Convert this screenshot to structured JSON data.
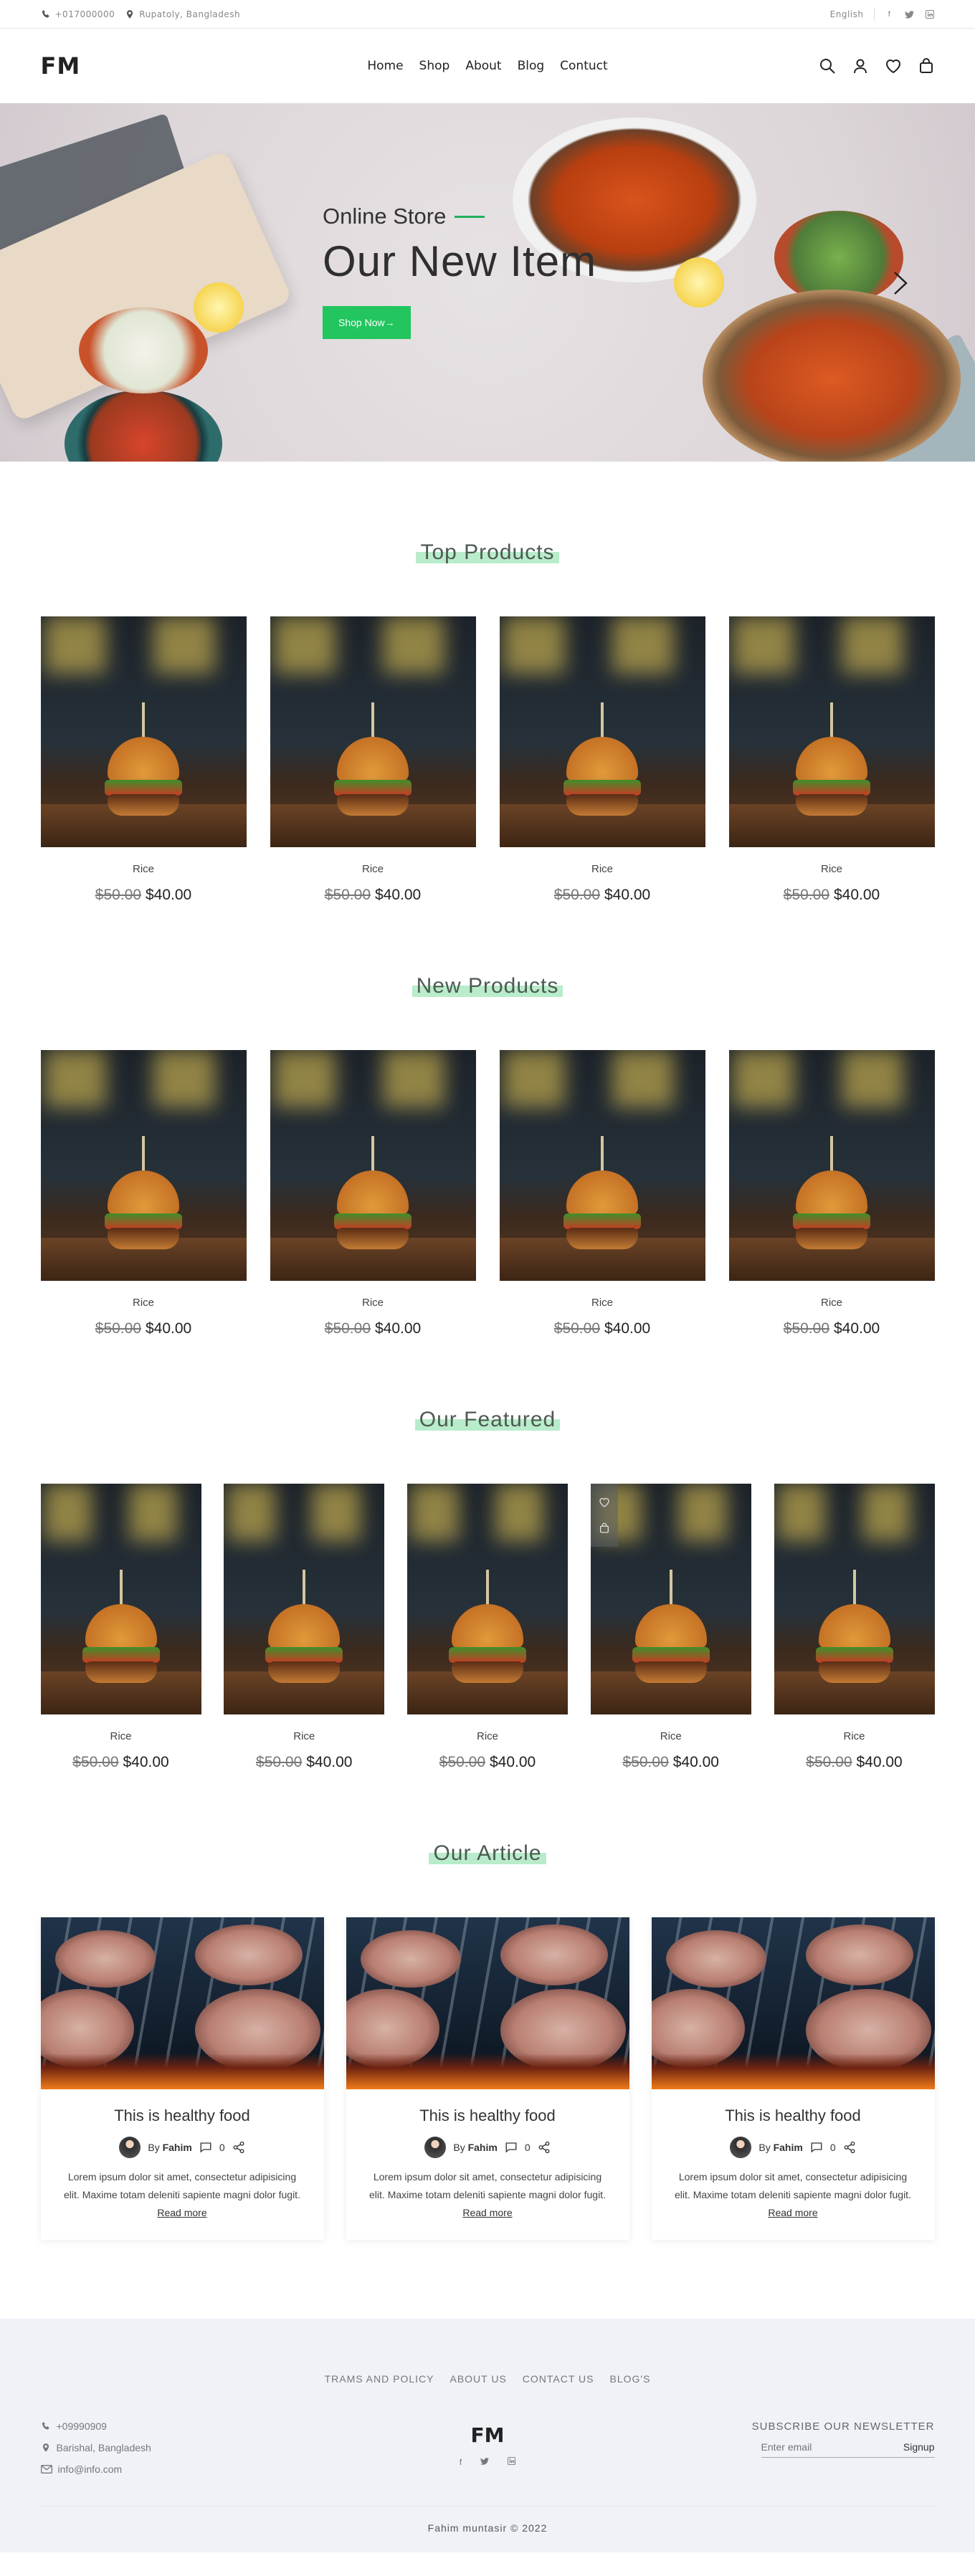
{
  "topbar": {
    "phone": "+017000000",
    "location": "Rupatoly, Bangladesh",
    "language": "English",
    "social": [
      "facebook-icon",
      "twitter-icon",
      "linkedin-icon"
    ]
  },
  "header": {
    "logo": "FM",
    "nav": [
      "Home",
      "Shop",
      "About",
      "Blog",
      "Contuct"
    ],
    "icons": [
      "search-icon",
      "user-icon",
      "heart-icon",
      "bag-icon"
    ]
  },
  "hero": {
    "subtitle": "Online Store",
    "title": "Our New Item",
    "button": "Shop Now→"
  },
  "top_products": {
    "title": "Top Products",
    "items": [
      {
        "name": "Rice",
        "old_price": "$50.00",
        "price": "$40.00"
      },
      {
        "name": "Rice",
        "old_price": "$50.00",
        "price": "$40.00"
      },
      {
        "name": "Rice",
        "old_price": "$50.00",
        "price": "$40.00"
      },
      {
        "name": "Rice",
        "old_price": "$50.00",
        "price": "$40.00"
      }
    ]
  },
  "new_products": {
    "title": "New Products",
    "items": [
      {
        "name": "Rice",
        "old_price": "$50.00",
        "price": "$40.00"
      },
      {
        "name": "Rice",
        "old_price": "$50.00",
        "price": "$40.00"
      },
      {
        "name": "Rice",
        "old_price": "$50.00",
        "price": "$40.00"
      },
      {
        "name": "Rice",
        "old_price": "$50.00",
        "price": "$40.00"
      }
    ]
  },
  "featured": {
    "title": "Our Featured",
    "items": [
      {
        "name": "Rice",
        "old_price": "$50.00",
        "price": "$40.00"
      },
      {
        "name": "Rice",
        "old_price": "$50.00",
        "price": "$40.00"
      },
      {
        "name": "Rice",
        "old_price": "$50.00",
        "price": "$40.00"
      },
      {
        "name": "Rice",
        "old_price": "$50.00",
        "price": "$40.00"
      },
      {
        "name": "Rice",
        "old_price": "$50.00",
        "price": "$40.00"
      }
    ]
  },
  "articles": {
    "title": "Our Article",
    "items": [
      {
        "title": "This is healthy food",
        "by": "By",
        "author": "Fahim",
        "comments": "0",
        "text": "Lorem ipsum dolor sit amet, consectetur adipisicing elit. Maxime totam deleniti sapiente magni dolor fugit.",
        "read_more": "Read more"
      },
      {
        "title": "This is healthy food",
        "by": "By",
        "author": "Fahim",
        "comments": "0",
        "text": "Lorem ipsum dolor sit amet, consectetur adipisicing elit. Maxime totam deleniti sapiente magni dolor fugit.",
        "read_more": "Read more"
      },
      {
        "title": "This is healthy food",
        "by": "By",
        "author": "Fahim",
        "comments": "0",
        "text": "Lorem ipsum dolor sit amet, consectetur adipisicing elit. Maxime totam deleniti sapiente magni dolor fugit.",
        "read_more": "Read more"
      }
    ]
  },
  "footer": {
    "links": [
      "TRAMS AND POLICY",
      "ABOUT US",
      "CONTACT US",
      "BLOG'S"
    ],
    "phone": "+09990909",
    "address": "Barishal, Bangladesh",
    "email": "info@info.com",
    "logo": "FM",
    "social": [
      "facebook-icon",
      "twitter-icon",
      "linkedin-icon"
    ],
    "newsletter_title": "SUBSCRIBE OUR NEWSLETTER",
    "email_placeholder": "Enter email",
    "signup": "Signup",
    "copyright": "Fahim muntasir © 2022"
  },
  "colors": {
    "accent": "#22c55e",
    "highlight": "#b9ecca",
    "footer_bg": "#f0f2f8"
  }
}
